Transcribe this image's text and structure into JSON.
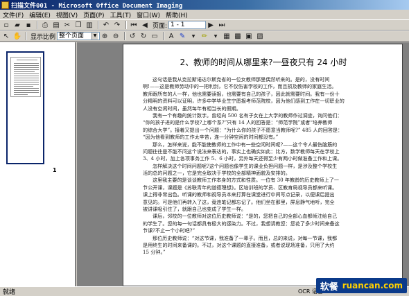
{
  "window": {
    "title": "扫描文件001 - Microsoft Office Document Imaging"
  },
  "menu": [
    "文件(F)",
    "编辑(E)",
    "视图(V)",
    "页面(P)",
    "工具(T)",
    "窗口(W)",
    "帮助(H)"
  ],
  "toolbar": {
    "page_label": "页面:",
    "page_value": "1 - 1"
  },
  "toolbar2": {
    "show_ratio_label": "显示比例",
    "zoom_value": "整个页面"
  },
  "thumbnails": {
    "page_number": "1"
  },
  "document": {
    "heading": "2、教师的时间从哪里来?一昼夜只有 24 小时",
    "paragraphs": [
      {
        "indent": true,
        "text": "这句话是我从克拉斯诺达尔斯克省的一位女教师那里偶然听来的。是的，没有时间"
      },
      {
        "indent": false,
        "text": "啊!——这是教师劳动中的一把利剑，它不仅伤害学校的工作，而且损及教师的家庭生活。"
      },
      {
        "indent": false,
        "text": "教师跟所有的人一样，他也需要读报，也需要有自己的孩子，因此就需要时间。我有一份十"
      },
      {
        "indent": false,
        "text": "分精明的资料可以证明，许多中学毕业生宁愿报考师范院校，因为他们感到工作在一切职业的"
      },
      {
        "indent": false,
        "text": "人没有空闲时间，虽然每年有相当长的假期。"
      },
      {
        "indent": true,
        "text": "我有一个有趣的统计数字。曾经向 500 名有子女在上大学的教师作过调查，询问他们："
      },
      {
        "indent": false,
        "text": "“你的孩子进的是什么学校?上哪个系?”只有 14 人的回答是：“师范学院”或者“培养教师"
      },
      {
        "indent": false,
        "text": "的综合大学”。接着又提出一个问题：“为什么你的孩子不愿意当教师呢?” 485 人的回答是："
      },
      {
        "indent": false,
        "text": "“因为他看到教师的工作太辛苦，连一分钟空闲的时间都没有。”"
      },
      {
        "indent": true,
        "text": "那么，怎样来说，能不能使教师的工作中有一些空闲时间呢?——这个令人最伤脑筋的"
      },
      {
        "indent": false,
        "text": "问题往往是不能不问这个说法来表达的，事实上也确实如此：比方，数学教师每天在学校上"
      },
      {
        "indent": false,
        "text": "3、4 小时，加上各项事务工作 5、6 小时，另外每天还得至少有两小时做准备工作和上课。"
      },
      {
        "indent": true,
        "text": "怎样解决这个时间问题呢?这个问题也像学生的课业负担问题一样，是涉及整个学校生"
      },
      {
        "indent": false,
        "text": "活的总的问题之一，它是完全取决于学校的全部精神面貌及安排的。"
      },
      {
        "indent": true,
        "text": "这里我主要的是谈谈教师工作本身的方式和性质。一位有 30 年教龄的历史教师上了一"
      },
      {
        "indent": false,
        "text": "节公开课，课题是《苏联青年的道德理想》。区培训班的学员、区教育局视导员都来听课。"
      },
      {
        "indent": false,
        "text": "课上得非常出色。听课的教师和视导员本来打算在课堂进行中间写点记录，以便课后提出"
      },
      {
        "indent": false,
        "text": "意见的。可是他们再转入了这，竟连笔记都忘记了。他们坐在那里，屏息静气地听，完全"
      },
      {
        "indent": false,
        "text": "被讲课吸引住了，就跟自己也变成了学生一样。"
      },
      {
        "indent": true,
        "text": "课后，邻校的一位教师对这位历史教师说：“是的，您把自己的全部心血都倾注给自己"
      },
      {
        "indent": false,
        "text": "的学生了。您的每一句话都具有极大的感染力。不过，我想请教您：您花了多少时间来备这"
      },
      {
        "indent": false,
        "text": "节课?不止一个小时吧?”"
      },
      {
        "indent": true,
        "text": "那位历史教师说：“对这节课，我准备了一辈子。而且，总的来说，对每一节课，我都"
      },
      {
        "indent": false,
        "text": "是用终生的时间来备课的。不过，对这个课题的直接准备，或者说现场准备，只用了大约"
      },
      {
        "indent": false,
        "text": "15 分钟。”"
      }
    ]
  },
  "status": {
    "text": "就绪",
    "ocr_language": "OCR 语言:"
  },
  "watermark": {
    "cn": "软餐",
    "en": "ruancan.com"
  },
  "colors": {
    "titlebar": "#0a246a",
    "selection": "#0a246a",
    "workspace": "#808080"
  }
}
